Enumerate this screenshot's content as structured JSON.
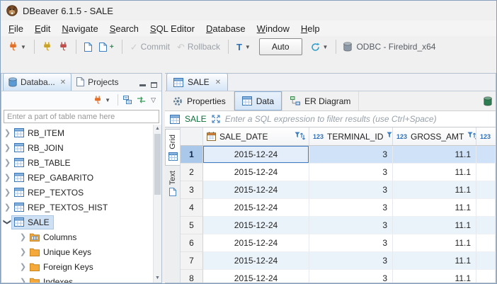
{
  "window": {
    "title": "DBeaver 6.1.5 - SALE"
  },
  "menubar": {
    "items": [
      "File",
      "Edit",
      "Navigate",
      "Search",
      "SQL Editor",
      "Database",
      "Window",
      "Help"
    ]
  },
  "toolbar": {
    "commit_label": "Commit",
    "rollback_label": "Rollback",
    "transaction_label": "T",
    "auto_label": "Auto",
    "connection_label": "ODBC - Firebird_x64"
  },
  "navigator": {
    "database_tab": "Databa...",
    "projects_tab": "Projects",
    "filter_placeholder": "Enter a part of table name here",
    "tree": [
      {
        "label": "RB_ITEM"
      },
      {
        "label": "RB_JOIN"
      },
      {
        "label": "RB_TABLE"
      },
      {
        "label": "REP_GABARITO"
      },
      {
        "label": "REP_TEXTOS"
      },
      {
        "label": "REP_TEXTOS_HIST"
      },
      {
        "label": "SALE"
      },
      {
        "label": "Columns"
      },
      {
        "label": "Unique Keys"
      },
      {
        "label": "Foreign Keys"
      },
      {
        "label": "Indexes"
      }
    ]
  },
  "editor": {
    "tab_label": "SALE",
    "subtabs": {
      "properties": "Properties",
      "data": "Data",
      "er_diagram": "ER Diagram"
    },
    "filter_table": "SALE",
    "filter_placeholder": "Enter a SQL expression to filter results (use Ctrl+Space)",
    "presentation": {
      "grid": "Grid",
      "text": "Text"
    }
  },
  "grid": {
    "numeric_type": "123",
    "columns": [
      "SALE_DATE",
      "TERMINAL_ID",
      "GROSS_AMT"
    ],
    "rows": [
      [
        "1",
        "2015-12-24",
        "3",
        "11.1"
      ],
      [
        "2",
        "2015-12-24",
        "3",
        "11.1"
      ],
      [
        "3",
        "2015-12-24",
        "3",
        "11.1"
      ],
      [
        "4",
        "2015-12-24",
        "3",
        "11.1"
      ],
      [
        "5",
        "2015-12-24",
        "3",
        "11.1"
      ],
      [
        "6",
        "2015-12-24",
        "3",
        "11.1"
      ],
      [
        "7",
        "2015-12-24",
        "3",
        "11.1"
      ],
      [
        "8",
        "2015-12-24",
        "3",
        "11.1"
      ]
    ]
  }
}
